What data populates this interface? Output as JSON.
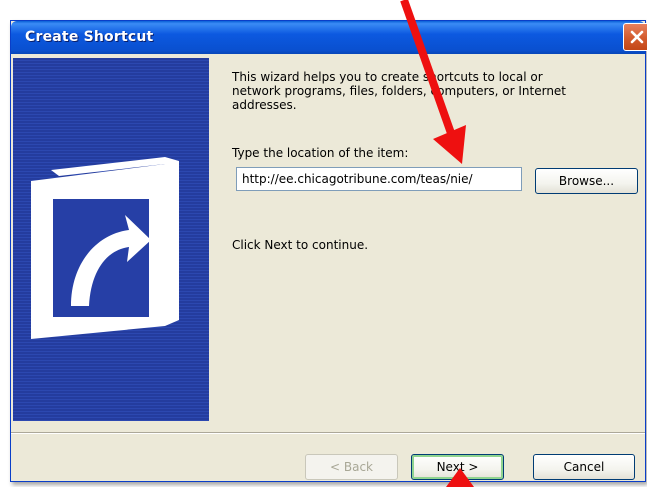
{
  "window": {
    "title": "Create Shortcut"
  },
  "wizard": {
    "intro_line1": "This wizard helps you to create shortcuts to local or",
    "intro_line2": "network programs, files, folders, computers, or Internet",
    "intro_line3": "addresses.",
    "location_label": "Type the location of the item:",
    "location_value": "http://ee.chicagotribune.com/teas/nie/",
    "browse_label": "Browse...",
    "continue_text": "Click Next to continue."
  },
  "buttons": {
    "back": "< Back",
    "next": "Next >",
    "cancel": "Cancel"
  },
  "icons": {
    "close": "close-icon",
    "shortcut": "shortcut-arrow-icon",
    "annotation": "red-arrow-icon"
  },
  "colors": {
    "title_bar": "#0a50d0",
    "banner": "#243c9e",
    "dialog_bg": "#ece9d8",
    "annotation_arrow": "#ee1010"
  }
}
